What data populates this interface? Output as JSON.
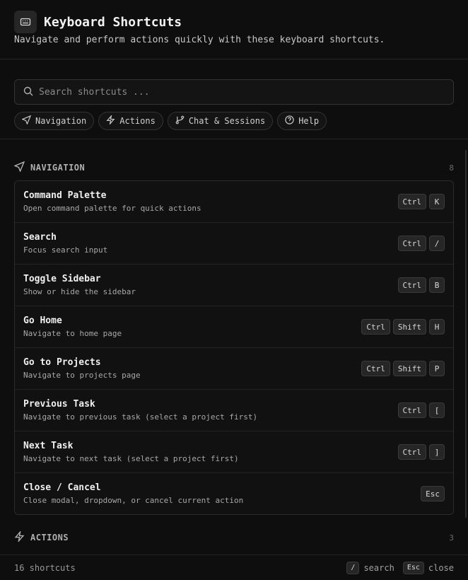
{
  "header": {
    "icon": "keyboard-icon",
    "title": "Keyboard Shortcuts",
    "subtitle": "Navigate and perform actions quickly with these keyboard shortcuts."
  },
  "search": {
    "icon": "search-icon",
    "placeholder": "Search shortcuts ..."
  },
  "chips": [
    {
      "icon": "send-icon",
      "label": "Navigation"
    },
    {
      "icon": "lightning-icon",
      "label": "Actions"
    },
    {
      "icon": "git-branch-icon",
      "label": "Chat & Sessions"
    },
    {
      "icon": "help-circle-icon",
      "label": "Help"
    }
  ],
  "sections": {
    "navigation": {
      "icon": "send-icon",
      "label": "NAVIGATION",
      "count": "8",
      "items": [
        {
          "title": "Command Palette",
          "desc": "Open command palette for quick actions",
          "keys": [
            "Ctrl",
            "K"
          ]
        },
        {
          "title": "Search",
          "desc": "Focus search input",
          "keys": [
            "Ctrl",
            "/"
          ]
        },
        {
          "title": "Toggle Sidebar",
          "desc": "Show or hide the sidebar",
          "keys": [
            "Ctrl",
            "B"
          ]
        },
        {
          "title": "Go Home",
          "desc": "Navigate to home page",
          "keys": [
            "Ctrl",
            "Shift",
            "H"
          ]
        },
        {
          "title": "Go to Projects",
          "desc": "Navigate to projects page",
          "keys": [
            "Ctrl",
            "Shift",
            "P"
          ]
        },
        {
          "title": "Previous Task",
          "desc": "Navigate to previous task (select a project first)",
          "keys": [
            "Ctrl",
            "["
          ]
        },
        {
          "title": "Next Task",
          "desc": "Navigate to next task (select a project first)",
          "keys": [
            "Ctrl",
            "]"
          ]
        },
        {
          "title": "Close / Cancel",
          "desc": "Close modal, dropdown, or cancel current action",
          "keys": [
            "Esc"
          ]
        }
      ]
    },
    "actions": {
      "icon": "lightning-icon",
      "label": "ACTIONS",
      "count": "3"
    }
  },
  "footer": {
    "count_text": "16 shortcuts",
    "hints": [
      {
        "key": "/",
        "label": "search"
      },
      {
        "key": "Esc",
        "label": "close"
      }
    ]
  },
  "colors": {
    "background": "#0e0e0e",
    "panel": "#111111",
    "border": "#2b2b2b",
    "key_bg": "#262626"
  }
}
